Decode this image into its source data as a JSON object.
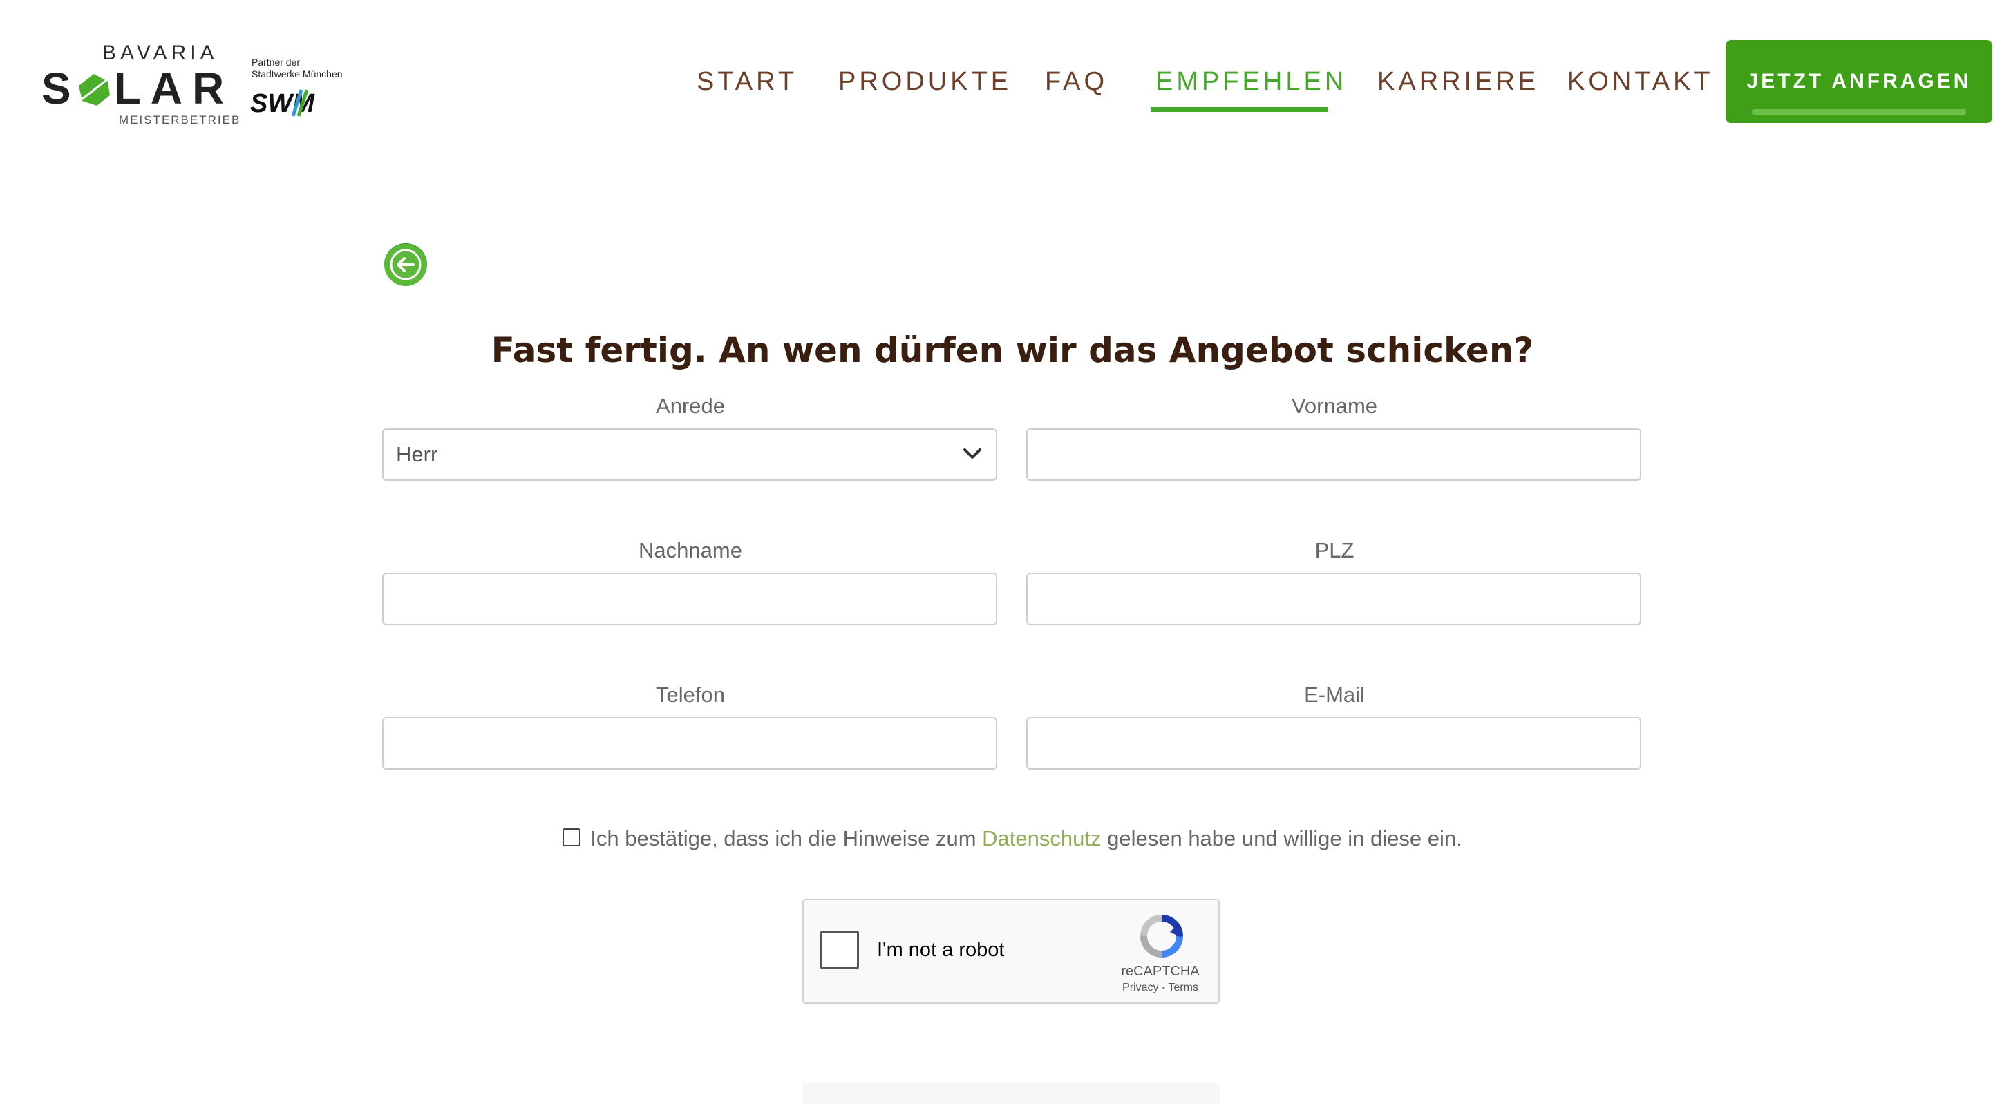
{
  "logo": {
    "top": "BAVARIA",
    "main_s": "S",
    "main_rest": "LAR",
    "sub": "MEISTERBETRIEB",
    "partner_line1": "Partner der",
    "partner_line2": "Stadtwerke München",
    "partner_brand": "SWM"
  },
  "nav": {
    "items": [
      {
        "label": "START"
      },
      {
        "label": "PRODUKTE"
      },
      {
        "label": "FAQ"
      },
      {
        "label": "EMPFEHLEN",
        "active": true
      },
      {
        "label": "KARRIERE"
      },
      {
        "label": "KONTAKT"
      }
    ],
    "cta": "JETZT ANFRAGEN"
  },
  "form": {
    "title": "Fast fertig. An wen dürfen wir das Angebot schicken?",
    "fields": {
      "anrede": {
        "label": "Anrede",
        "value": "Herr"
      },
      "vorname": {
        "label": "Vorname",
        "value": ""
      },
      "nachname": {
        "label": "Nachname",
        "value": ""
      },
      "plz": {
        "label": "PLZ",
        "value": ""
      },
      "telefon": {
        "label": "Telefon",
        "value": ""
      },
      "email": {
        "label": "E-Mail",
        "value": ""
      }
    },
    "consent": {
      "before": "Ich bestätige, dass ich die Hinweise zum ",
      "link": "Datenschutz",
      "after": " gelesen habe und willige in diese ein."
    }
  },
  "recaptcha": {
    "label": "I'm not a robot",
    "brand": "reCAPTCHA",
    "privacy": "Privacy",
    "sep": " - ",
    "terms": "Terms"
  },
  "colors": {
    "accent": "#45a82b",
    "nav_text": "#6b3f2a",
    "title": "#3a1e0f",
    "link": "#8fae55"
  }
}
